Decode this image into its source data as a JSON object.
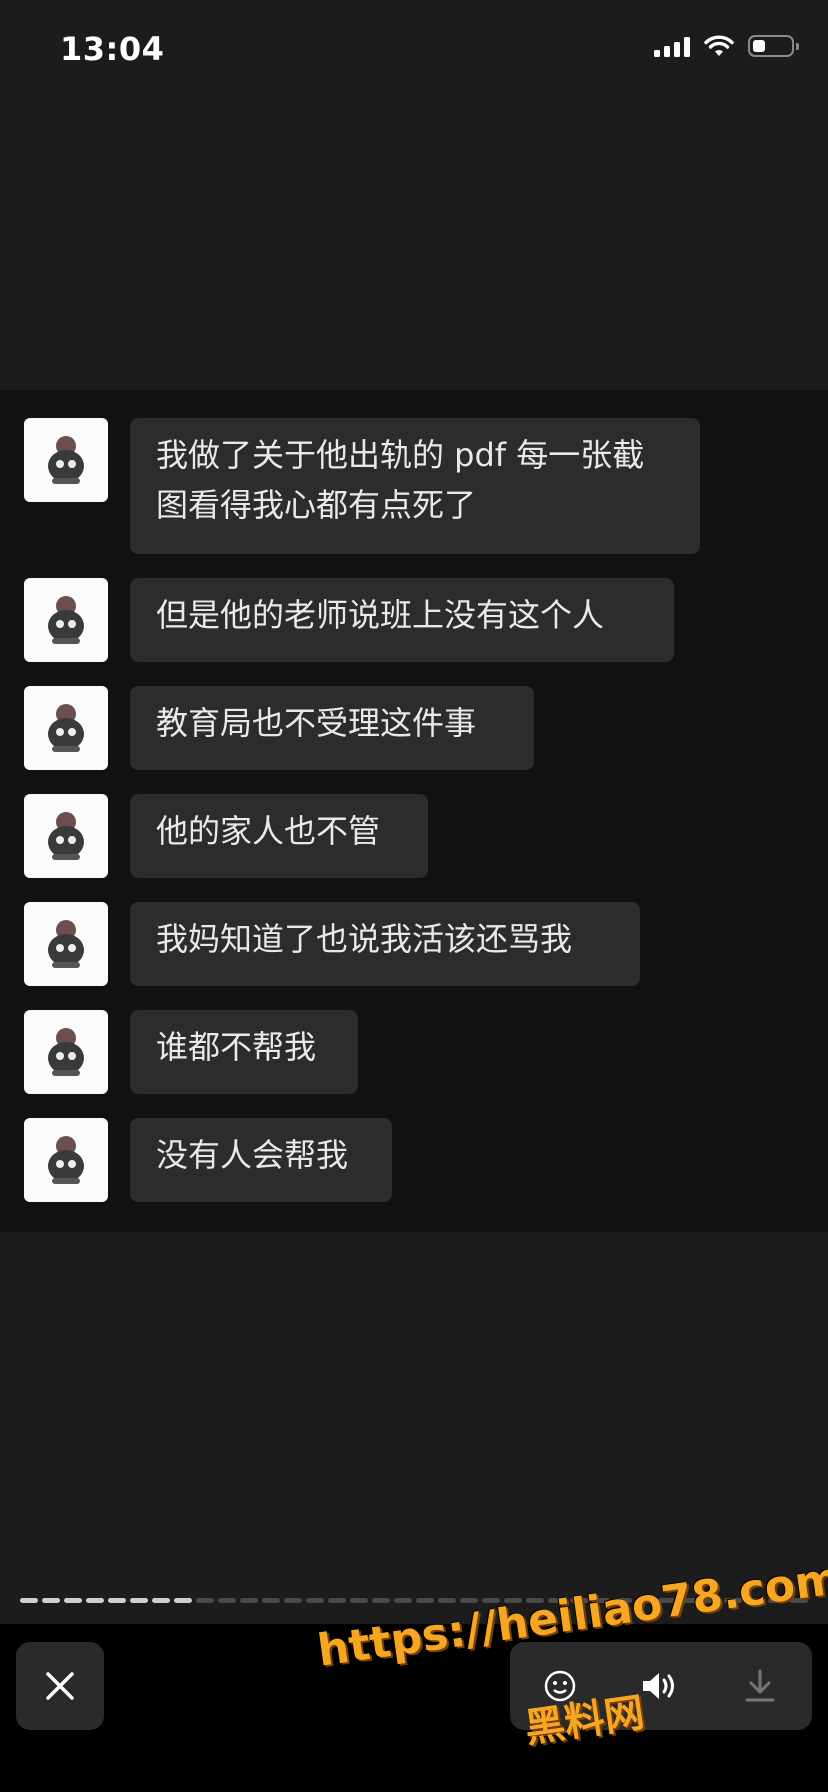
{
  "status_bar": {
    "time": "13:04"
  },
  "messages": [
    {
      "text": "我做了关于他出轨的 pdf 每一张截\n图看得我心都有点死了"
    },
    {
      "text": "但是他的老师说班上没有这个人"
    },
    {
      "text": "教育局也不受理这件事"
    },
    {
      "text": "他的家人也不管"
    },
    {
      "text": "我妈知道了也说我活该还骂我"
    },
    {
      "text": "谁都不帮我"
    },
    {
      "text": "没有人会帮我"
    }
  ],
  "progress": {
    "total_segments": 36,
    "viewed_segments": 8
  },
  "controls": {
    "close_icon": "close-icon",
    "sound_icon": "speaker-icon",
    "download_icon": "download-icon"
  },
  "watermark": {
    "url": "https://heiliao78.com",
    "brand": "黑料网"
  },
  "colors": {
    "background": "#1c1c1c",
    "chat_panel": "#111111",
    "bubble": "#2c2c2c",
    "watermark": "#f5a623"
  }
}
